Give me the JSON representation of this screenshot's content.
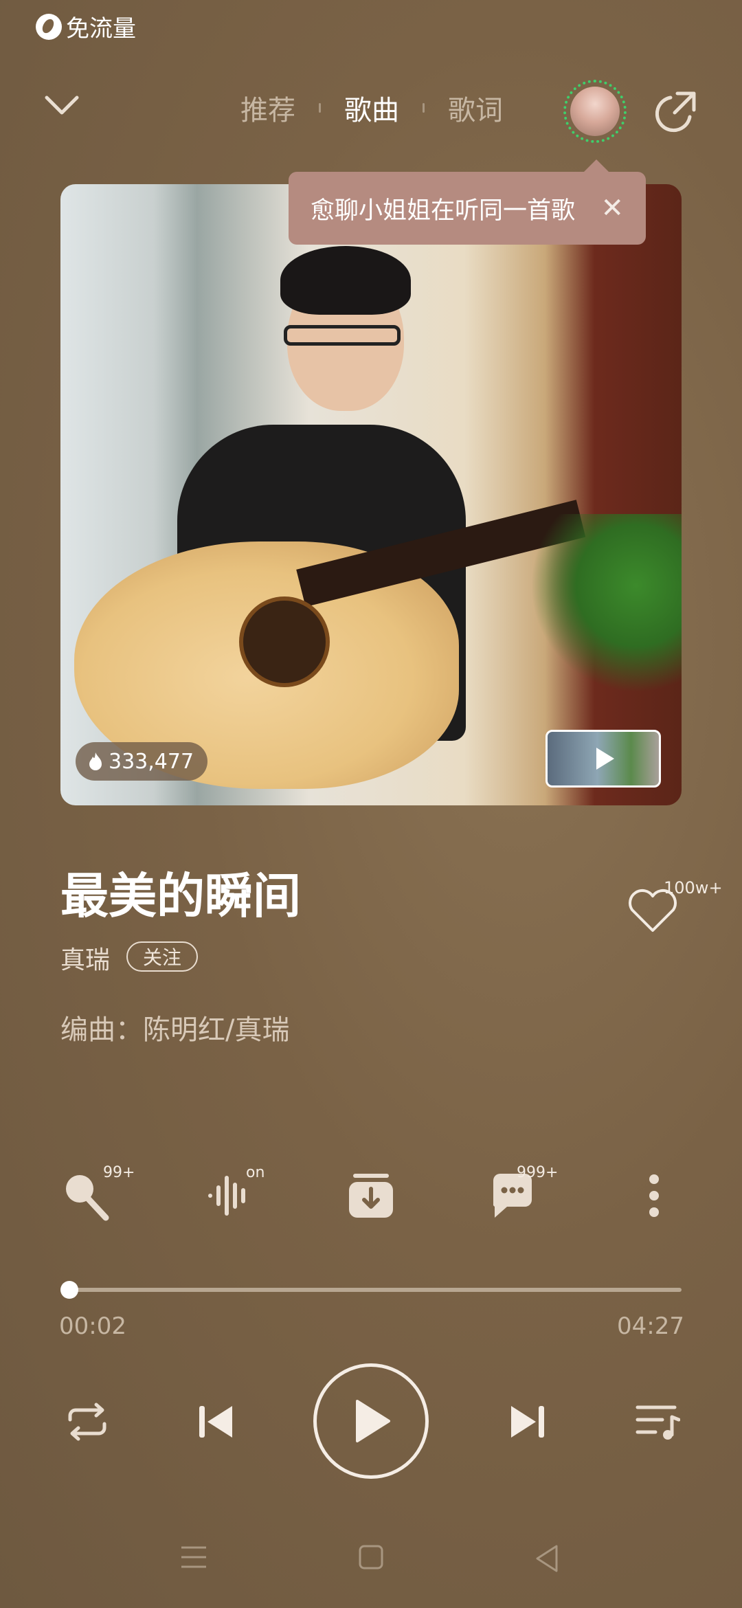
{
  "status": {
    "traffic_label": "免流量"
  },
  "header": {
    "tabs": [
      {
        "label": "推荐"
      },
      {
        "label": "歌曲"
      },
      {
        "label": "歌词"
      }
    ],
    "active_tab": "歌曲"
  },
  "tooltip": {
    "text": "愈聊小姐姐在听同一首歌",
    "close": "✕"
  },
  "cover": {
    "hot_count": "333,477"
  },
  "song": {
    "title": "最美的瞬间",
    "artist": "真瑞",
    "follow_label": "关注",
    "composer": "编曲：陈明红/真瑞",
    "likes": "100w+"
  },
  "actions": {
    "sing_badge": "99+",
    "effect_badge": "on",
    "comment_badge": "999+"
  },
  "player": {
    "current_time": "00:02",
    "total_time": "04:27",
    "progress": 0.008
  },
  "colors": {
    "accent_ring": "#3fcf6b",
    "tooltip_bg": "#b58b80",
    "background": "#7a6246"
  }
}
